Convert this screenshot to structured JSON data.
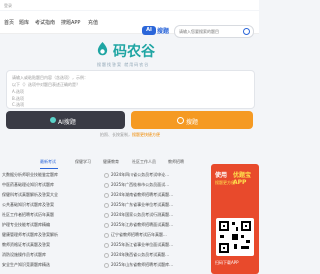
{
  "topbar": {
    "text": "登录"
  },
  "nav": {
    "items": [
      "首页",
      "题库",
      "考试指南",
      "搜题APP",
      "充值"
    ]
  },
  "search": {
    "ai_badge": "AI",
    "ai_word": "搜题",
    "placeholder": "请输入您要搜索的题目"
  },
  "logo": {
    "name": "码农谷",
    "tagline": "搜题找答案 就用码农谷"
  },
  "question_box": {
    "line1": "请输入或粘贴题目内容（含选项），示例：",
    "line2": "以下（）选项中对题目表述正确的是？",
    "line3": "A.选项",
    "line4": "B.选项",
    "line5": "C.选项"
  },
  "buttons": {
    "ai": "AI搜题",
    "search": "搜题"
  },
  "links": {
    "a": "拍照、长按复制，",
    "b": "搜题更快捷方便"
  },
  "tabs": [
    "最新考试",
    "保健学习",
    "健康教育",
    "社区工作人员",
    "教师招聘"
  ],
  "list": [
    [
      "大数据分析师职业技能鉴定题库",
      "2024年四川省公务员考试申论..."
    ],
    [
      "中医药基础理论知识考试题库",
      "2025年广西桂林市公务员面试..."
    ],
    [
      "保健科考试真题解析及答案大全",
      "2024年湖南省教师招聘考试真题..."
    ],
    [
      "公共基础知识考试题库及答案",
      "2025年广东省事业单位考试真题..."
    ],
    [
      "社区工作者招聘考试历年真题",
      "2024年国家公务员考试行测真题..."
    ],
    [
      "护理专业技能考试题库精编",
      "2025年江苏省教师招聘面试真题..."
    ],
    [
      "健康管理师考试题库及答案解析",
      "辽宁省教师招聘考试历年真题..."
    ],
    [
      "教师资格证考试真题及答案",
      "2025年浙江省事业单位面试真题..."
    ],
    [
      "消防设施操作员考试题库",
      "2024年陕西省公务员考试真题..."
    ],
    [
      "安全生产知识竞赛题库精选",
      "2025年山东省教师招聘考试题库..."
    ]
  ],
  "ad": {
    "title_a": "使用",
    "title_b": "优题宝APP",
    "sub": "搜题更方便",
    "foot": "扫码下载APP"
  }
}
